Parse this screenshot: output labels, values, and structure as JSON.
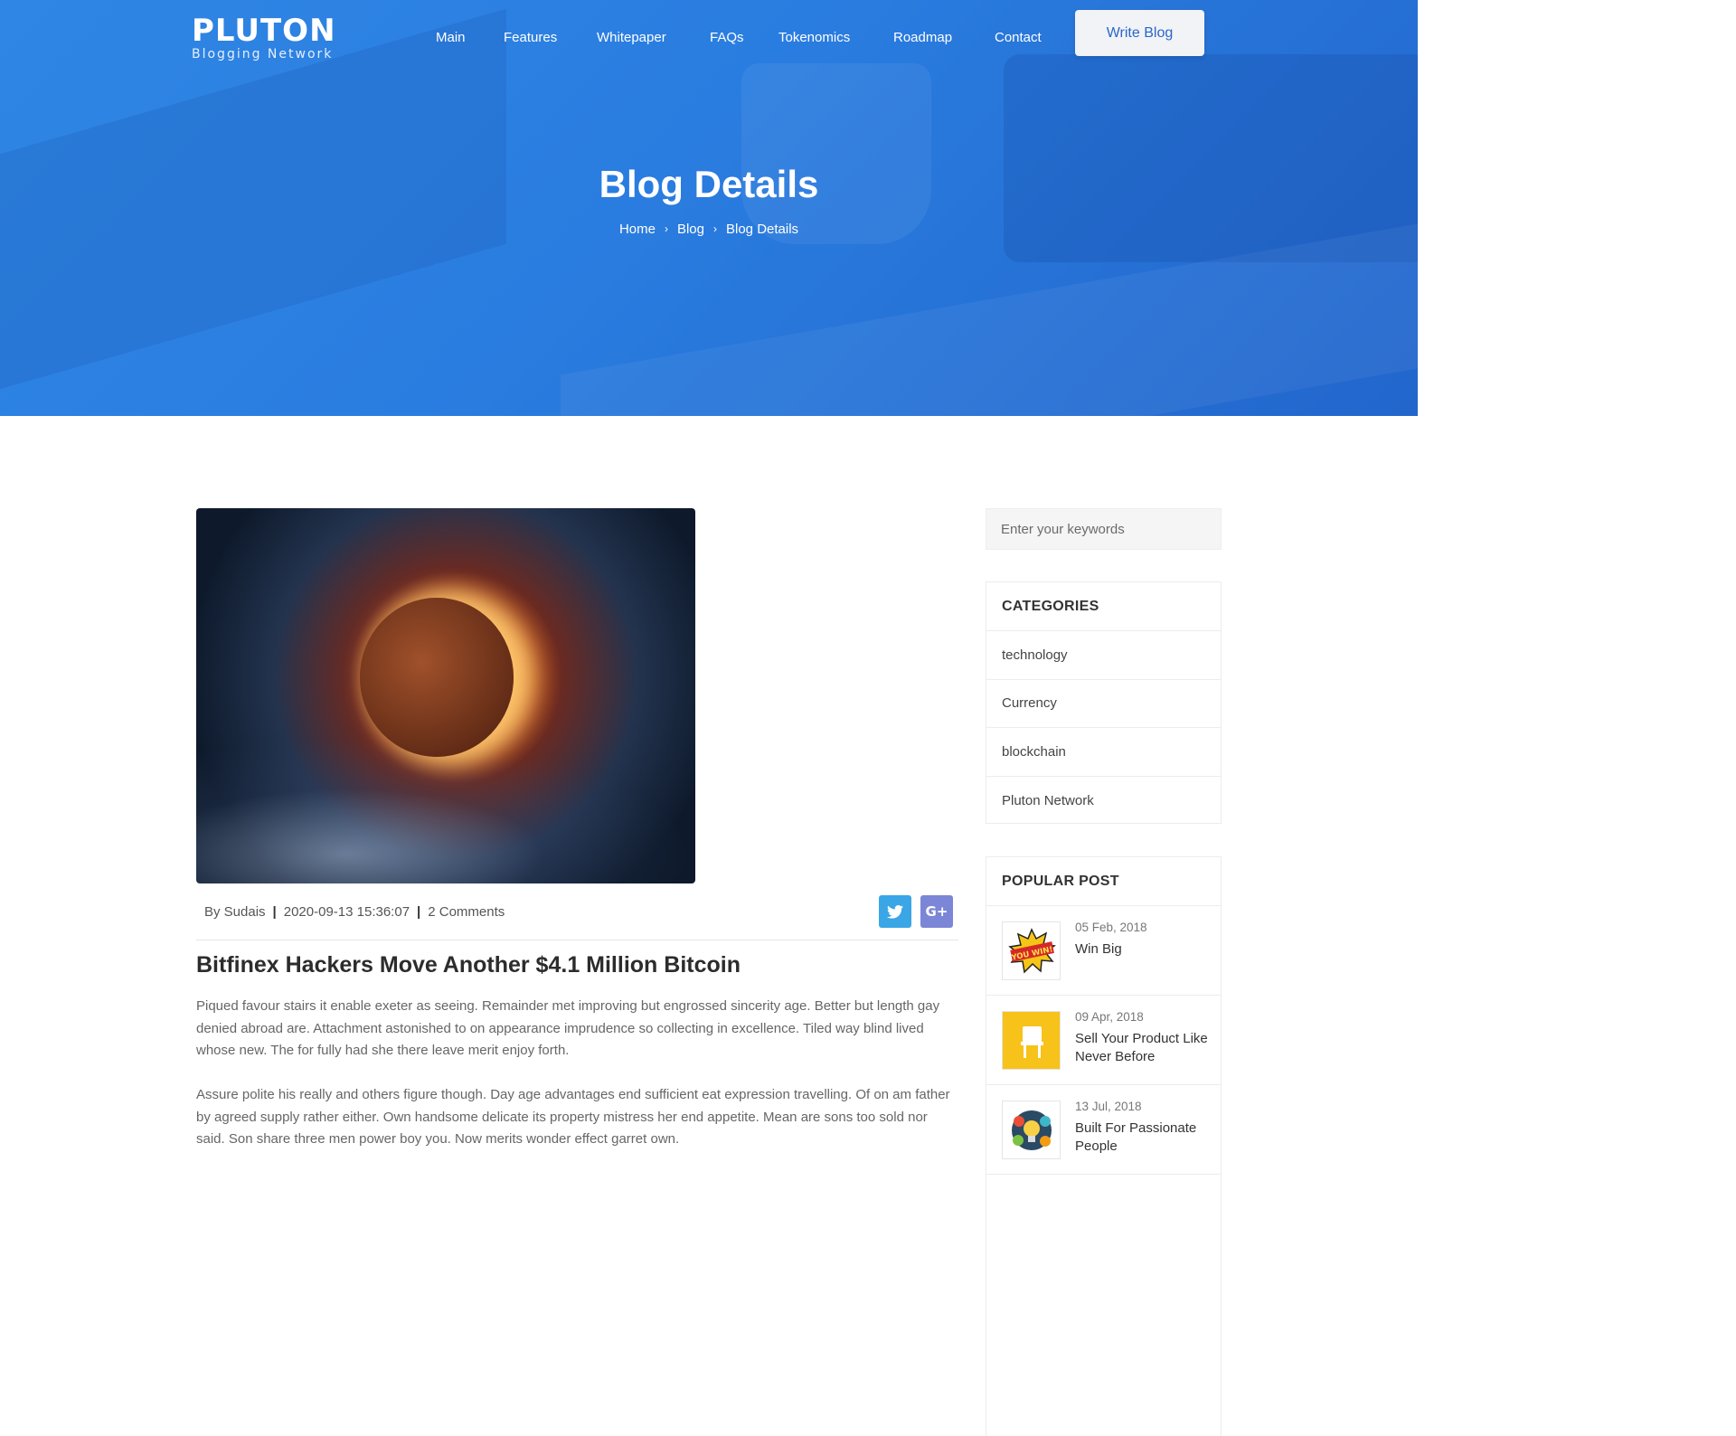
{
  "header": {
    "logo_main": "PLUTON",
    "logo_sub": "Blogging Network",
    "nav": [
      "Main",
      "Features",
      "Whitepaper",
      "FAQs",
      "Tokenomics",
      "Roadmap",
      "Contact"
    ],
    "write_blog_label": "Write Blog"
  },
  "hero": {
    "title": "Blog Details",
    "breadcrumb": [
      "Home",
      "Blog",
      "Blog Details"
    ],
    "separator": "›"
  },
  "post": {
    "author": "By Sudais",
    "date": "2020-09-13 15:36:07",
    "comments": "2 Comments",
    "meta_separator": "|",
    "share": {
      "twitter_glyph": "🐦",
      "google_plus_label": "G+"
    },
    "title": "Bitfinex Hackers Move Another $4.1 Million Bitcoin",
    "paragraphs": [
      "Piqued favour stairs it enable exeter as seeing. Remainder met improving but engrossed sincerity age. Better but length gay denied abroad are. Attachment astonished to on appearance imprudence so collecting in excellence. Tiled way blind lived whose new. The for fully had she there leave merit enjoy forth.",
      "Assure polite his really and others figure though. Day age advantages end sufficient eat expression travelling. Of on am father by agreed supply rather either. Own handsome delicate its property mistress her end appetite. Mean are sons too sold nor said. Son share three men power boy you. Now merits wonder effect garret own."
    ]
  },
  "sidebar": {
    "search_placeholder": "Enter your keywords",
    "categories_title": "CATEGORIES",
    "categories": [
      "technology",
      "Currency",
      "blockchain",
      "Pluton Network"
    ],
    "popular_title": "POPULAR POST",
    "popular": [
      {
        "date": "05 Feb, 2018",
        "title": "Win Big",
        "thumb": "you-win-badge",
        "thumb_text": "YOU WIN!"
      },
      {
        "date": "09 Apr, 2018",
        "title": "Sell Your Product Like Never Before",
        "thumb": "product-chair",
        "thumb_text": ""
      },
      {
        "date": "13 Jul, 2018",
        "title": "Built For Passionate People",
        "thumb": "lightbulb-gears",
        "thumb_text": ""
      }
    ]
  },
  "colors": {
    "hero_blue": "#2a7de0",
    "write_blog_text": "#2a66c8",
    "twitter": "#3aa6e6",
    "google_plus": "#7c86d6"
  }
}
